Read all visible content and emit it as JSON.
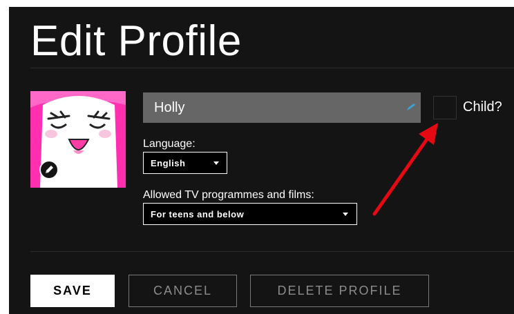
{
  "page": {
    "title": "Edit Profile"
  },
  "profile": {
    "name_value": "Holly",
    "avatar_icon": "cartoon-face-avatar",
    "child_label": "Child?",
    "child_checked": false
  },
  "language": {
    "label": "Language:",
    "selected": "English"
  },
  "maturity": {
    "label": "Allowed TV programmes and films:",
    "selected": "For teens and below"
  },
  "actions": {
    "save_label": "SAVE",
    "cancel_label": "CANCEL",
    "delete_label": "DELETE PROFILE"
  },
  "colors": {
    "background": "#141414",
    "avatar_pink": "#ff2fb0",
    "input_gray": "#666666",
    "annotation_red": "#e50914"
  }
}
